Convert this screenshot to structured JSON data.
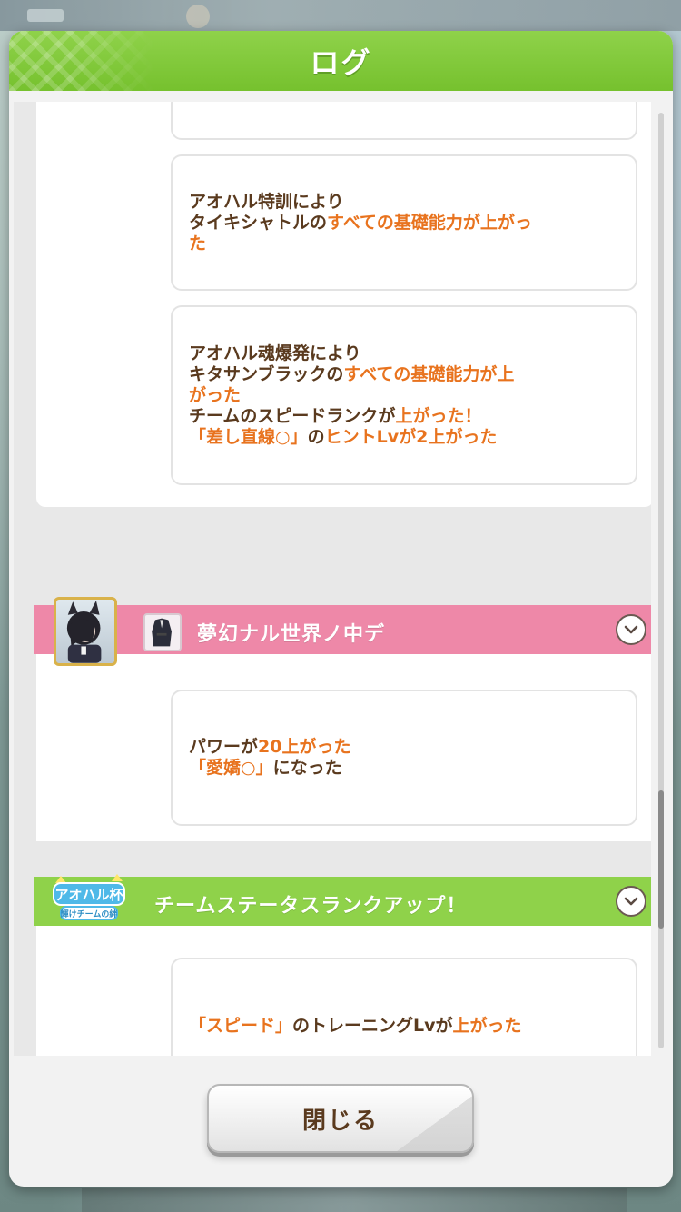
{
  "background": {
    "top_bar_text": "",
    "colors": {
      "header_green": "#8fd24a",
      "banner_pink": "#ee88a8",
      "text_brown": "#5a3a1e",
      "highlight_orange": "#e8731e"
    }
  },
  "dialog": {
    "title": "ログ",
    "close_label": "閉じる"
  },
  "log": {
    "group1": {
      "entries": [
        {
          "parts": []
        },
        {
          "parts": [
            {
              "text": "アオハル特訓により",
              "hl": false,
              "br": true
            },
            {
              "text": "タイキシャトルの",
              "hl": false
            },
            {
              "text": "すべての基礎能力が上がっ",
              "hl": true,
              "br": true
            },
            {
              "text": "た",
              "hl": true
            }
          ]
        },
        {
          "parts": [
            {
              "text": "アオハル魂爆発により",
              "hl": false,
              "br": true
            },
            {
              "text": "キタサンブラックの",
              "hl": false
            },
            {
              "text": "すべての基礎能力が上",
              "hl": true,
              "br": true
            },
            {
              "text": "がった",
              "hl": true,
              "br": true
            },
            {
              "text": "チームのスピードランクが",
              "hl": false
            },
            {
              "text": "上がった！",
              "hl": true,
              "br": true
            },
            {
              "text": "「差し直線○」",
              "hl": true
            },
            {
              "text": "の",
              "hl": false
            },
            {
              "text": "ヒントLvが2上がった",
              "hl": true
            }
          ]
        }
      ]
    },
    "group2": {
      "title": "夢幻ナル世界ノ中デ",
      "avatar_icon": "character-portrait-icon",
      "outfit_icon": "outfit-icon",
      "entries": [
        {
          "parts": [
            {
              "text": "パワーが",
              "hl": false
            },
            {
              "text": "20上がった",
              "hl": true,
              "br": true
            },
            {
              "text": "「愛嬌○」",
              "hl": true
            },
            {
              "text": "になった",
              "hl": false
            }
          ]
        }
      ]
    },
    "group3": {
      "title": "チームステータスランクアップ！",
      "logo_text": "アオハル杯",
      "logo_subtext": "輝けチームの絆",
      "entries": [
        {
          "parts": [
            {
              "text": "「スピード」",
              "hl": true
            },
            {
              "text": "のトレーニングLvが",
              "hl": false
            },
            {
              "text": "上がった",
              "hl": true
            }
          ]
        }
      ]
    }
  },
  "scrollbar": {
    "position": 0.85
  }
}
